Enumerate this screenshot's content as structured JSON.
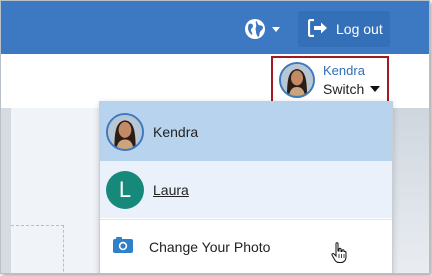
{
  "header": {
    "language_icon": "globe-icon",
    "logout_icon": "logout-icon",
    "logout_label": "Log out",
    "brand_color": "#3d79c2"
  },
  "user_switch": {
    "name": "Kendra",
    "label": "Switch",
    "highlight_color": "#a11a22"
  },
  "dropdown": {
    "items": [
      {
        "label": "Kendra",
        "type": "photo-avatar",
        "selected": true
      },
      {
        "label": "Laura",
        "type": "initial-avatar",
        "initial": "L",
        "avatar_color": "#16897a",
        "hovered": true
      },
      {
        "label": "Change Your Photo",
        "icon": "camera-icon"
      }
    ]
  }
}
